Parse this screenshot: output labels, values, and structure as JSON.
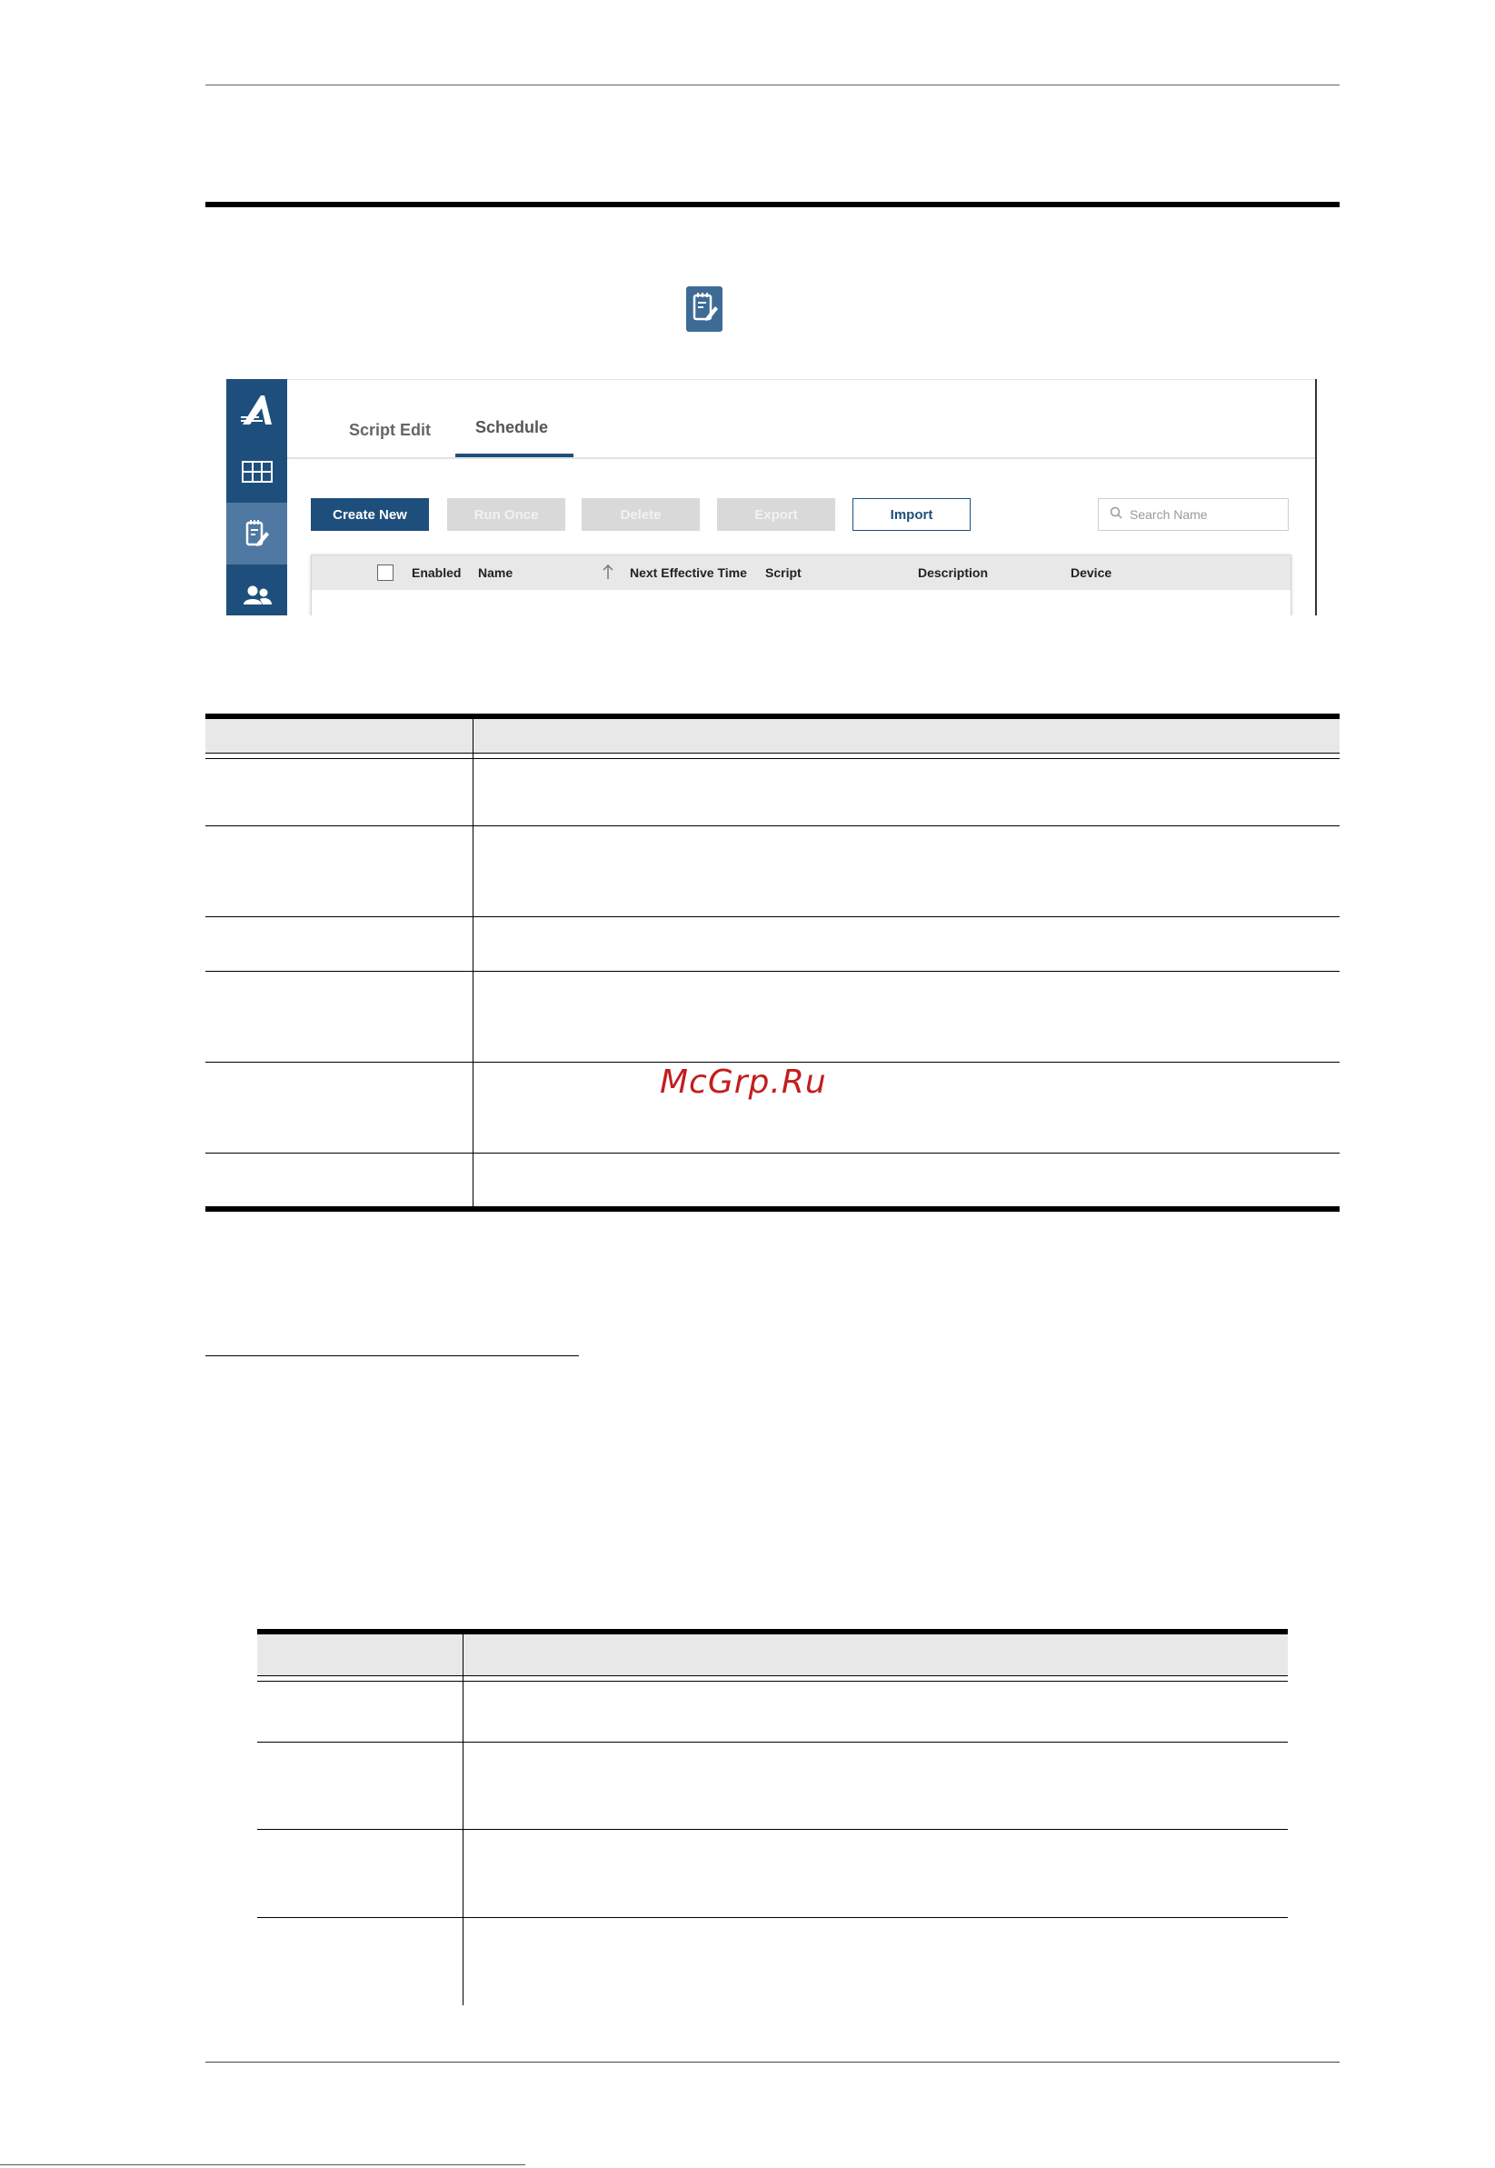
{
  "screenshot": {
    "tabs": [
      {
        "label": "Script Edit",
        "active": false
      },
      {
        "label": "Schedule",
        "active": true
      }
    ],
    "toolbar": {
      "create_new": "Create New",
      "run_once": "Run Once",
      "delete": "Delete",
      "export": "Export",
      "import": "Import"
    },
    "search": {
      "placeholder": "Search Name"
    },
    "columns": [
      "Enabled",
      "Name",
      "Next Effective Time",
      "Script",
      "Description",
      "Device"
    ],
    "sidebar_icons": [
      "logo-icon",
      "grid-icon",
      "script-edit-icon",
      "users-icon"
    ],
    "colors": {
      "primary": "#1e4f7c",
      "sidebar_active": "#4f79a2",
      "disabled": "#d9d9d9"
    }
  },
  "watermark": "McGrp.Ru"
}
